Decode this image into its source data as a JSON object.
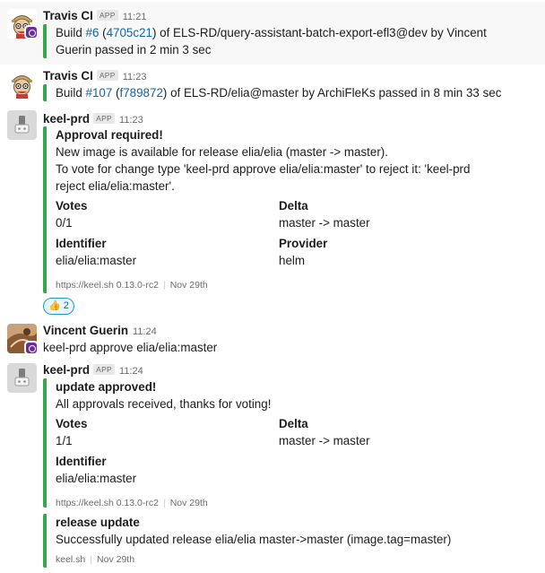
{
  "messages": {
    "travis1": {
      "name": "Travis CI",
      "badge": "APP",
      "time": "11:21",
      "text_a": "Build ",
      "build_num": "#6",
      "paren_open": " (",
      "commit": "4705c21",
      "text_b": ") of ELS-RD/query-assistant-batch-export-efl3@dev by Vincent",
      "text_c": "Guerin passed in 2 min 3 sec"
    },
    "travis2": {
      "name": "Travis CI",
      "badge": "APP",
      "time": "11:23",
      "text_a": "Build ",
      "build_num": "#107",
      "paren_open": " (",
      "commit": "f789872",
      "text_b": ") of ELS-RD/elia@master by ArchiFleKs passed in 8 min 33 sec"
    },
    "keel1": {
      "name": "keel-prd",
      "badge": "APP",
      "time": "11:23",
      "title": "Approval required!",
      "line1": "New image is available for release elia/elia (master -> master).",
      "line2": "To vote for change type 'keel-prd approve elia/elia:master' to reject it: 'keel-prd",
      "line3": "reject elia/elia:master'.",
      "fields": [
        {
          "title": "Votes",
          "value": "0/1"
        },
        {
          "title": "Delta",
          "value": "master -> master"
        },
        {
          "title": "Identifier",
          "value": "elia/elia:master"
        },
        {
          "title": "Provider",
          "value": "helm"
        }
      ],
      "footer_src": "https://keel.sh 0.13.0-rc2",
      "footer_date": "Nov 29th",
      "reaction_emoji": "👍",
      "reaction_count": "2"
    },
    "vincent": {
      "name": "Vincent Guerin",
      "time": "11:24",
      "text": "keel-prd approve elia/elia:master"
    },
    "keel2": {
      "name": "keel-prd",
      "badge": "APP",
      "time": "11:24",
      "title": "update approved!",
      "line1": "All approvals received, thanks for voting!",
      "fields": [
        {
          "title": "Votes",
          "value": "1/1"
        },
        {
          "title": "Delta",
          "value": "master -> master"
        },
        {
          "title": "Identifier",
          "value": "elia/elia:master"
        }
      ],
      "footer_src": "https://keel.sh 0.13.0-rc2",
      "footer_date": "Nov 29th",
      "att2_title": "release update",
      "att2_text": "Successfully updated release elia/elia master->master (image.tag=master)",
      "att2_footer_src": "keel.sh",
      "att2_footer_date": "Nov 29th"
    }
  },
  "colors": {
    "attachment_bar": "#36a64f",
    "link": "#1264a3",
    "badge_workspace": "#6e2aa6"
  },
  "icons": {
    "travis_avatar": "travis-mascot-icon",
    "keel_avatar": "keel-robot-icon",
    "reaction": "thumbs-up-icon"
  }
}
